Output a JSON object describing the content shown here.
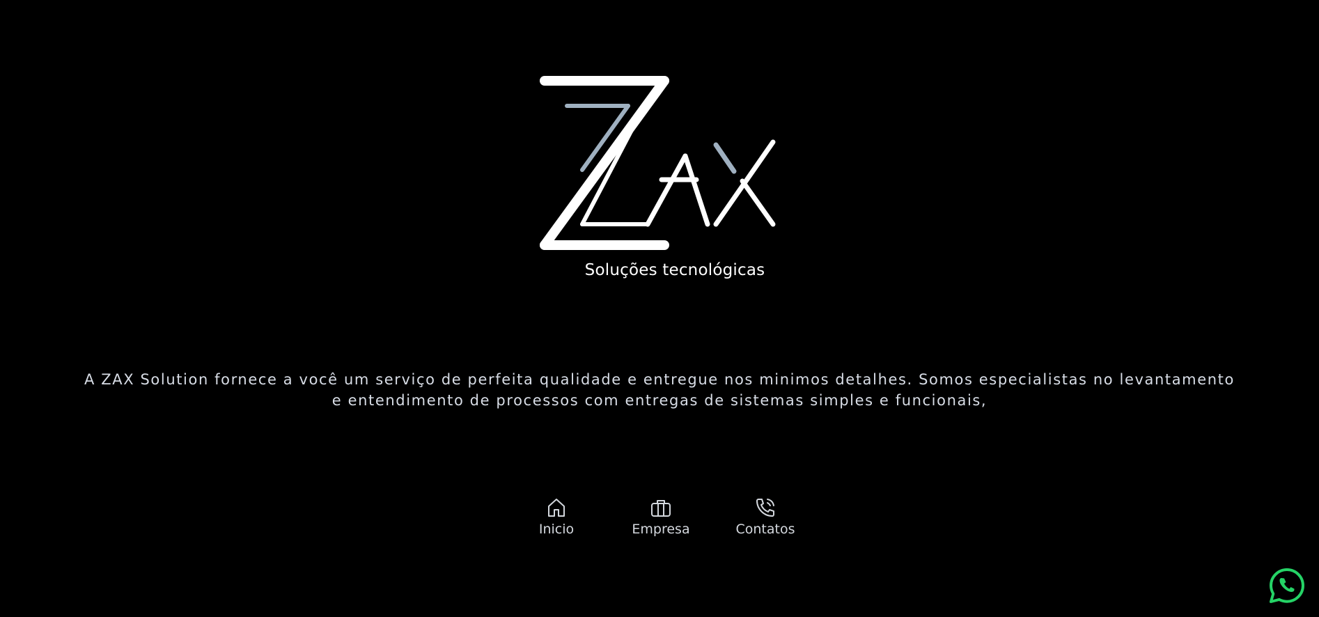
{
  "brand": {
    "logo_text": "ZAX",
    "tagline": "Soluções tecnológicas"
  },
  "description": {
    "text": "A ZAX Solution fornece a você um serviço de perfeita qualidade e entregue nos minimos detalhes. Somos especialistas no levantamento e entendimento de processos com entregas de sistemas simples e funcionais,"
  },
  "nav": {
    "items": [
      {
        "label": "Inicio",
        "icon": "home-icon"
      },
      {
        "label": "Empresa",
        "icon": "briefcase-icon"
      },
      {
        "label": "Contatos",
        "icon": "phone-icon"
      }
    ]
  },
  "whatsapp": {
    "icon": "whatsapp-icon",
    "color": "#25d366"
  },
  "colors": {
    "background": "#000000",
    "logo_white": "#ffffff",
    "logo_accent": "#9fb0c0",
    "text": "#d8dde6"
  }
}
